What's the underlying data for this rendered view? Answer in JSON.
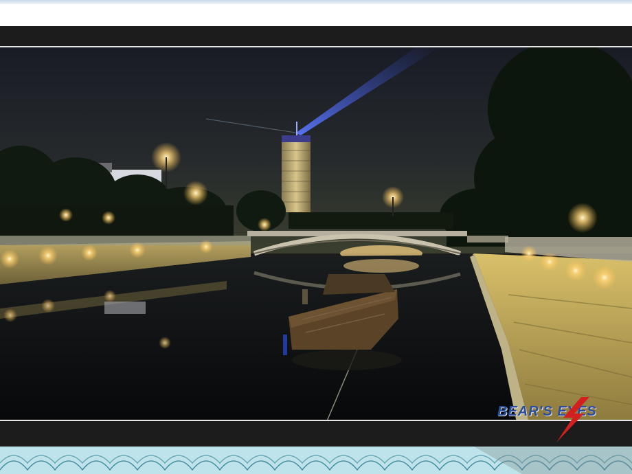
{
  "watermark": {
    "text": "BEAR'S EYES"
  },
  "colors": {
    "sky_top": "#1a1d26",
    "sky_bottom": "#343a30",
    "frame": "#1c1c1c",
    "water": "#0d0f12",
    "lamp_glow": "#ffd98a",
    "spotlight": "#3a5cff",
    "watermark": "#2a4e9c",
    "wave_band": "#bfe3ea"
  },
  "icons": {
    "watermark_bolt": "lightning-bolt-icon"
  }
}
